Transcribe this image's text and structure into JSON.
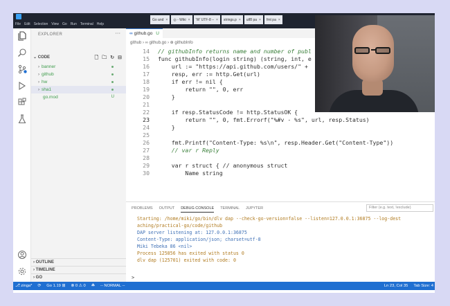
{
  "window": {
    "menu": [
      "File",
      "Edit",
      "Selection",
      "View",
      "Go",
      "Run",
      "Terminal",
      "Help"
    ],
    "browser_tabs": [
      {
        "label": "Go and ",
        "icon": "tab-icon"
      },
      {
        "label": "◎ - Wiki",
        "icon": "tab-icon"
      },
      {
        "label": "‘W’ UTF-8 –",
        "icon": "tab-icon"
      },
      {
        "label": "strings.p",
        "icon": "tab-icon"
      },
      {
        "label": "utf8 pa",
        "icon": "tab-icon"
      },
      {
        "label": "fmt pa",
        "icon": "tab-icon"
      }
    ]
  },
  "sidebar": {
    "title": "EXPLORER",
    "root": "CODE",
    "items": [
      {
        "label": "banner",
        "color": "#3f9c4c",
        "folder": true
      },
      {
        "label": "github",
        "color": "#3f9c4c",
        "folder": true
      },
      {
        "label": "hw",
        "color": "#3f9c4c",
        "folder": true
      },
      {
        "label": "sha1",
        "color": "#3f9c4c",
        "folder": true
      },
      {
        "label": "go.mod",
        "color": "#3f9c4c",
        "folder": false,
        "mark": "U"
      }
    ],
    "sections": [
      "OUTLINE",
      "TIMELINE",
      "GO"
    ]
  },
  "editor": {
    "tab_label": "github.go",
    "tab_status": "U",
    "breadcrumb": "github › ∞ github.go › ⊕ githubInfo",
    "lines": [
      {
        "n": "14",
        "text": "// githubInfo returns name and number of publ"
      },
      {
        "n": "15",
        "text": "func githubInfo(login string) (string, int, e"
      },
      {
        "n": "16",
        "text": "    url := \"https://api.github.com/users/\" +"
      },
      {
        "n": "17",
        "text": "    resp, err := http.Get(url)"
      },
      {
        "n": "18",
        "text": "    if err != nil {"
      },
      {
        "n": "19",
        "text": "        return \"\", 0, err"
      },
      {
        "n": "20",
        "text": "    }"
      },
      {
        "n": "21",
        "text": ""
      },
      {
        "n": "22",
        "text": "    if resp.StatusCode != http.StatusOK {"
      },
      {
        "n": "23",
        "text": "        return \"\", 0, fmt.Errorf(\"%#v - %s\", url, resp.Status)"
      },
      {
        "n": "24",
        "text": "    }"
      },
      {
        "n": "25",
        "text": ""
      },
      {
        "n": "26",
        "text": "    fmt.Printf(\"Content-Type: %s\\n\", resp.Header.Get(\"Content-Type\"))"
      },
      {
        "n": "27",
        "text": "    // var r Reply"
      },
      {
        "n": "28",
        "text": ""
      },
      {
        "n": "29",
        "text": "    var r struct { // anonymous struct"
      },
      {
        "n": "30",
        "text": "        Name string"
      }
    ]
  },
  "panel": {
    "tabs": [
      "PROBLEMS",
      "OUTPUT",
      "DEBUG CONSOLE",
      "TERMINAL",
      "JUPYTER"
    ],
    "active_tab": "DEBUG CONSOLE",
    "filter_placeholder": "Filter (e.g. text, !exclude)",
    "console": [
      {
        "text": "Starting: /home/miki/go/bin/dlv dap --check-go-version=false --listen=127.0.0.1:36875 --log-dest",
        "color": "#b07a1e"
      },
      {
        "text": "aching/practical-go/code/github",
        "color": "#b07a1e"
      },
      {
        "text": "DAP server listening at: 127.0.0.1:36875",
        "color": "#3d6fb5"
      },
      {
        "text": "Content-Type: application/json; charset=utf-8",
        "color": "#3d6fb5"
      },
      {
        "text": "Miki Tebeka 86 <nil>",
        "color": "#3d6fb5"
      },
      {
        "text": "Process 125856 has exited with status 0",
        "color": "#b07a1e"
      },
      {
        "text": "dlv dap (125701) exited with code: 0",
        "color": "#b07a1e"
      }
    ],
    "prompt": ">"
  },
  "statusbar": {
    "left": [
      "⎇ zinga*",
      "⟳",
      "Go 1.19 ⊞",
      "⊗ 0 ⚠ 0",
      "☘",
      "-- NORMAL --"
    ],
    "right": [
      "Ln 23, Col 35",
      "Tab Size: 4"
    ]
  },
  "colors": {
    "statusbar": "#1f6fd1",
    "accent": "#3f7cd1",
    "background": "#d8d9f4"
  }
}
